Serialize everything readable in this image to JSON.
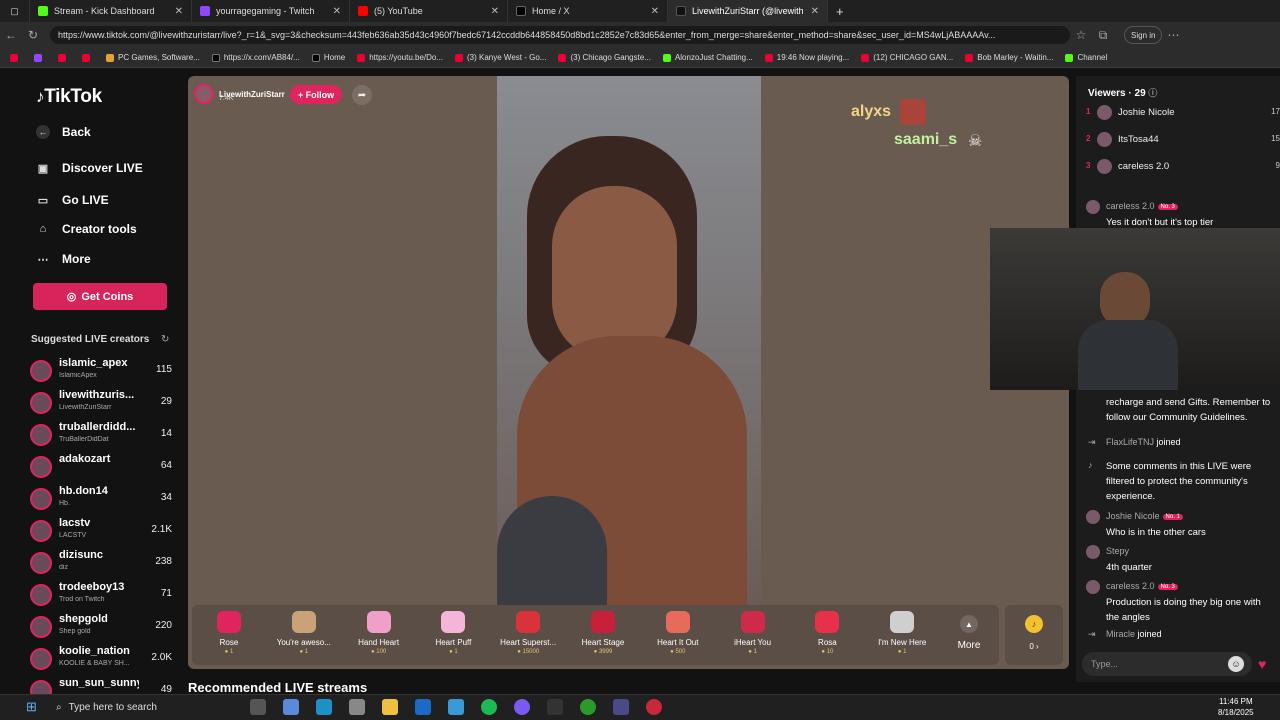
{
  "browser": {
    "tabs": [
      {
        "label": "Stream - Kick Dashboard",
        "color": "#53fc18"
      },
      {
        "label": "yourragegaming - Twitch",
        "color": "#9146ff"
      },
      {
        "label": "(5) YouTube",
        "color": "#ff0000"
      },
      {
        "label": "Home / X",
        "color": "#000000"
      },
      {
        "label": "LivewithZuriStarr (@livewithzuristarr)",
        "color": "#111111"
      }
    ],
    "url": "https://www.tiktok.com/@livewithzuristarr/live?_r=1&_svg=3&checksum=443feb636ab35d43c4960f7bedc67142ccddb644858450d8bd1c2852e7c83d65&enter_from_merge=share&enter_method=share&sec_user_id=MS4wLjABAAAAv...",
    "signin": "Sign in",
    "bookmarks": [
      "PC Games, Software...",
      "https://x.com/AB84/...",
      "Home",
      "https://youtu.be/Do...",
      "(3) Kanye West - Go...",
      "(3) Chicago Gangste...",
      "AlonzoJust Chatting...",
      "19:46 Now playing...",
      "(12) CHICAGO GAN...",
      "Bob Marley - Waitin...",
      "Channel"
    ]
  },
  "sidebar": {
    "logo": "TikTok",
    "back": "Back",
    "nav": [
      "Discover LIVE",
      "Go LIVE",
      "Creator tools",
      "More"
    ],
    "get_coins": "Get Coins",
    "suggested_title": "Suggested LIVE creators",
    "creators": [
      {
        "name": "islamic_apex",
        "sub": "IslamicApex",
        "count": "115"
      },
      {
        "name": "livewithzuris...",
        "sub": "LivewithZuriStarr",
        "count": "29"
      },
      {
        "name": "truballerdidd...",
        "sub": "TruBallerDidDat",
        "count": "14"
      },
      {
        "name": "adakozart",
        "sub": "",
        "count": "64"
      },
      {
        "name": "hb.don14",
        "sub": "Hb.",
        "count": "34"
      },
      {
        "name": "lacstv",
        "sub": "LACSTV",
        "count": "2.1K"
      },
      {
        "name": "dizisunc",
        "sub": "diz",
        "count": "238"
      },
      {
        "name": "trodeeboy13",
        "sub": "Trod on Twitch",
        "count": "71"
      },
      {
        "name": "shepgold",
        "sub": "Shep gold",
        "count": "220"
      },
      {
        "name": "koolie_nation",
        "sub": "KOOLIE & BABY SH...",
        "count": "2.0K"
      },
      {
        "name": "sun_sun_sunny",
        "sub": "",
        "count": "49"
      }
    ]
  },
  "stream": {
    "host": "LivewithZuriStarr",
    "host_count": "7.4K",
    "follow": "+ Follow",
    "float1": "alyxs",
    "float2": "saami_s",
    "gifts": [
      {
        "name": "Rose",
        "price": "1",
        "color": "#e0245e"
      },
      {
        "name": "You're aweso...",
        "price": "1",
        "color": "#c9a27a"
      },
      {
        "name": "Hand Heart",
        "price": "100",
        "color": "#f0a0c8"
      },
      {
        "name": "Heart Puff",
        "price": "1",
        "color": "#f5b4d8"
      },
      {
        "name": "Heart Superst...",
        "price": "15000",
        "color": "#d8323a"
      },
      {
        "name": "Heart Stage",
        "price": "3999",
        "color": "#c8203a"
      },
      {
        "name": "Heart It Out",
        "price": "500",
        "color": "#e86a5a"
      },
      {
        "name": "iHeart You",
        "price": "1",
        "color": "#d02a4a"
      },
      {
        "name": "Rosa",
        "price": "10",
        "color": "#e8304a"
      },
      {
        "name": "I'm New Here",
        "price": "1",
        "color": "#cfcfcf"
      }
    ],
    "more": "More",
    "coins": "0 ›",
    "recommended": "Recommended LIVE streams"
  },
  "chat": {
    "viewers_title": "Viewers · 29",
    "viewers": [
      {
        "rank": "1",
        "name": "Joshie Nicole",
        "count": "17"
      },
      {
        "rank": "2",
        "name": "ItsTosa44",
        "count": "15"
      },
      {
        "rank": "3",
        "name": "careless 2.0",
        "count": "9"
      }
    ],
    "comments": [
      {
        "user": "careless 2.0",
        "badge": "No. 3",
        "text": "Yes it don't but it's top tier"
      },
      {
        "user": "",
        "badge": "",
        "text": "LIVE. Viewers must be 18 or older to recharge and send Gifts. Remember to follow our Community Guidelines."
      },
      {
        "user": "FlaxLifeTNJ",
        "badge": "",
        "text": "joined"
      },
      {
        "user": "",
        "badge": "",
        "text": "Some comments in this LIVE were filtered to protect the community's experience."
      },
      {
        "user": "Joshie Nicole",
        "badge": "No. 1",
        "text": "Who is in the other cars"
      },
      {
        "user": "Stepy",
        "badge": "",
        "text": "4th quarter"
      },
      {
        "user": "careless 2.0",
        "badge": "No. 3",
        "text": "Production is doing they big one with the angles"
      },
      {
        "user": "Miracle",
        "badge": "",
        "text": "joined"
      }
    ],
    "placeholder": "Type..."
  },
  "taskbar": {
    "search": "Type here to search",
    "time": "11:46 PM",
    "date": "8/18/2025"
  }
}
